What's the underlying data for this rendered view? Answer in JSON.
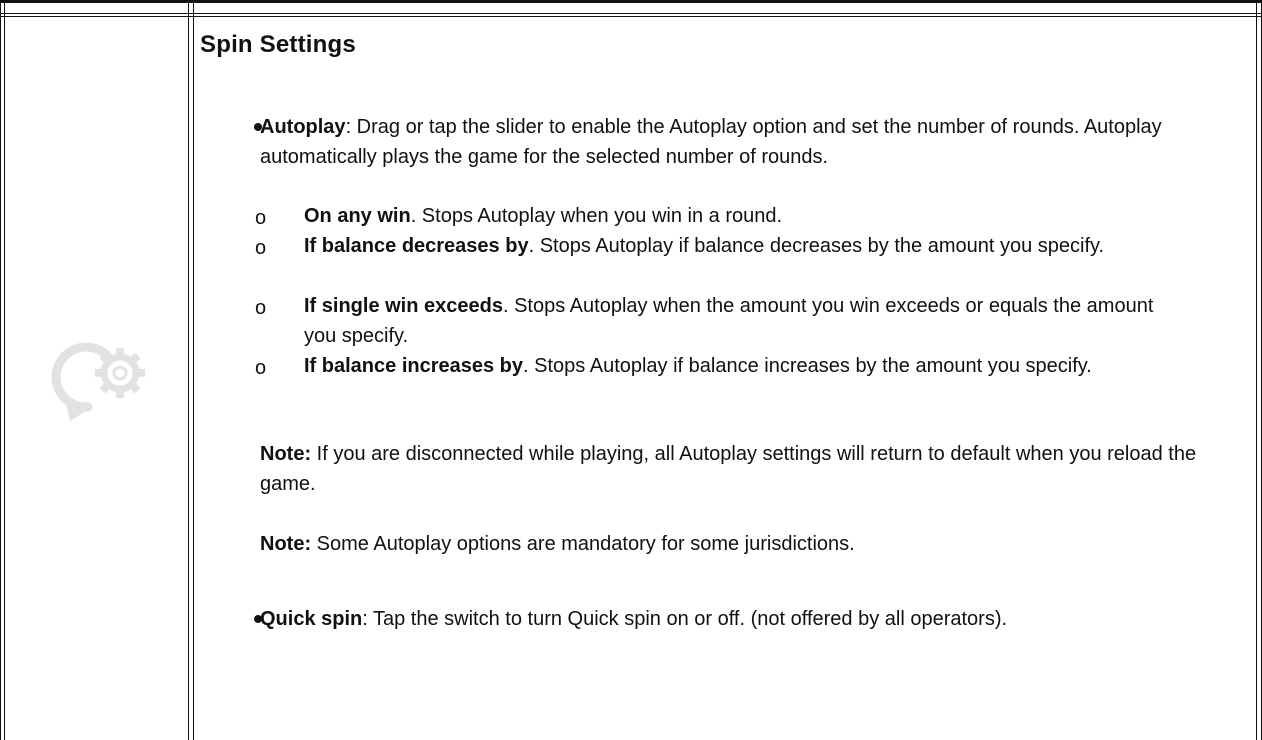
{
  "section": {
    "title": "Spin Settings",
    "icon": "autoplay-gear-icon"
  },
  "autoplay": {
    "label": "Autoplay",
    "text": ": Drag or tap the slider to enable the Autoplay option and set the number of rounds. Autoplay automatically plays the game for the selected number of rounds.",
    "options": [
      {
        "marker": "o",
        "label": "On any win",
        "text": ". Stops Autoplay when you win in a round."
      },
      {
        "marker": "o",
        "label": "If balance decreases by",
        "text": ". Stops Autoplay if balance decreases by the amount you specify."
      },
      {
        "marker": "o",
        "label": "If single win exceeds",
        "text": ". Stops Autoplay when the amount you win exceeds or equals the amount you specify."
      },
      {
        "marker": "o",
        "label": "If balance increases by",
        "text": ". Stops Autoplay if balance increases by the amount you specify."
      }
    ]
  },
  "notes": [
    {
      "label": "Note:",
      "text": " If you are disconnected while playing, all Autoplay settings will return to default when you reload the game."
    },
    {
      "label": "Note:",
      "text": " Some Autoplay options are mandatory for some jurisdictions."
    }
  ],
  "quick_spin": {
    "label": "Quick spin",
    "text": ": Tap the switch to turn Quick spin on or off. (not offered by all operators)."
  },
  "colors": {
    "border": "#111111",
    "icon": "#e2e2e2",
    "text": "#111111"
  }
}
